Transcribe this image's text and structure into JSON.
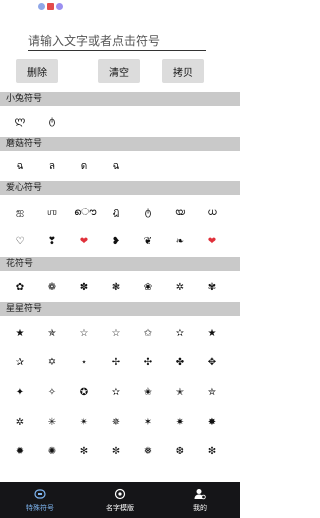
{
  "input": {
    "placeholder": "请输入文字或者点击符号"
  },
  "buttons": {
    "delete": "删除",
    "clear": "清空",
    "copy": "拷贝"
  },
  "sections": {
    "rabbit": {
      "title": "小兔符号",
      "symbols": [
        "ლ",
        "ტ"
      ]
    },
    "mushroom": {
      "title": "蘑菇符号",
      "symbols": [
        "ฉ",
        "ล",
        "ด",
        "ฉ"
      ]
    },
    "love": {
      "title": "爱心符号",
      "row1": [
        "ஐ",
        "ஶ",
        "ൌ",
        "ฎ",
        "ტ",
        "യ",
        "ധ"
      ],
      "row2": [
        "♡",
        "❣",
        "❤",
        "❥",
        "❦",
        "❧",
        "❤"
      ]
    },
    "flower": {
      "title": "花符号",
      "symbols": [
        "✿",
        "❁",
        "✽",
        "❃",
        "❀",
        "✲",
        "✾"
      ]
    },
    "star": {
      "title": "星星符号",
      "rows": [
        [
          "★",
          "✯",
          "☆",
          "☆",
          "✩",
          "✫",
          "★"
        ],
        [
          "✰",
          "✡",
          "⋆",
          "✢",
          "✣",
          "✤",
          "✥"
        ],
        [
          "✦",
          "✧",
          "✪",
          "✫",
          "✬",
          "✭",
          "✮"
        ],
        [
          "✲",
          "✳",
          "✴",
          "✵",
          "✶",
          "✷",
          "✸"
        ],
        [
          "✹",
          "✺",
          "✻",
          "✼",
          "❅",
          "❆",
          "❇"
        ]
      ]
    }
  },
  "nav": {
    "tab1": "特殊符号",
    "tab2": "名字模版",
    "tab3": "我的"
  }
}
